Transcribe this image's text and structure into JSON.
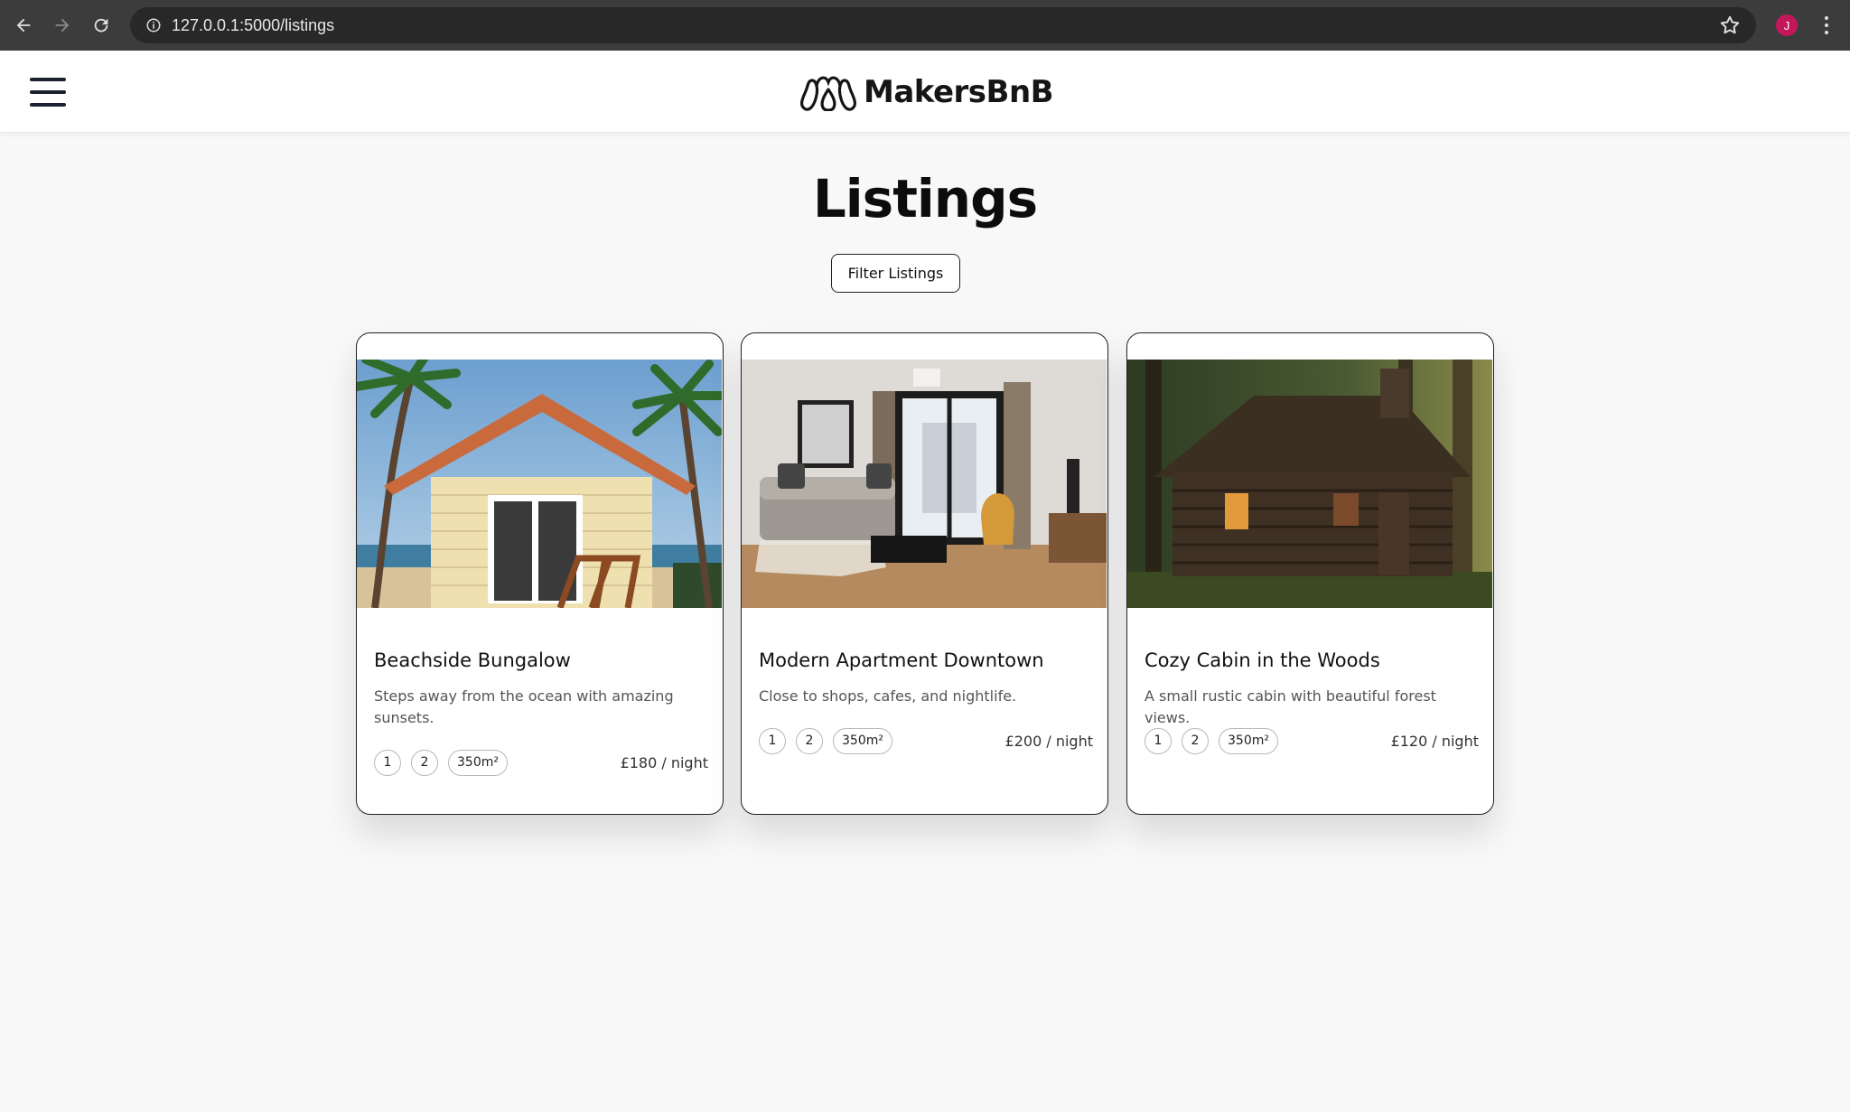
{
  "browser": {
    "url": "127.0.0.1:5000/listings",
    "profile_initial": "J"
  },
  "header": {
    "brand": "MakersBnB"
  },
  "main": {
    "title": "Listings",
    "filter_label": "Filter Listings"
  },
  "listings": [
    {
      "title": "Beachside Bungalow",
      "description": "Steps away from the ocean with amazing sunsets.",
      "tag1": "1",
      "tag2": "2",
      "area": "350m²",
      "price": "£180 / night",
      "image": "beach-bungalow-photo"
    },
    {
      "title": "Modern Apartment Downtown",
      "description": "Close to shops, cafes, and nightlife.",
      "tag1": "1",
      "tag2": "2",
      "area": "350m²",
      "price": "£200 / night",
      "image": "modern-apartment-photo"
    },
    {
      "title": "Cozy Cabin in the Woods",
      "description": "A small rustic cabin with beautiful forest views.",
      "tag1": "1",
      "tag2": "2",
      "area": "350m²",
      "price": "£120 / night",
      "image": "forest-cabin-photo"
    }
  ],
  "colors": {
    "browser_bar": "#3c3c3c",
    "page_bg": "#f8f8f8",
    "text": "#111111",
    "avatar": "#c2185b"
  }
}
